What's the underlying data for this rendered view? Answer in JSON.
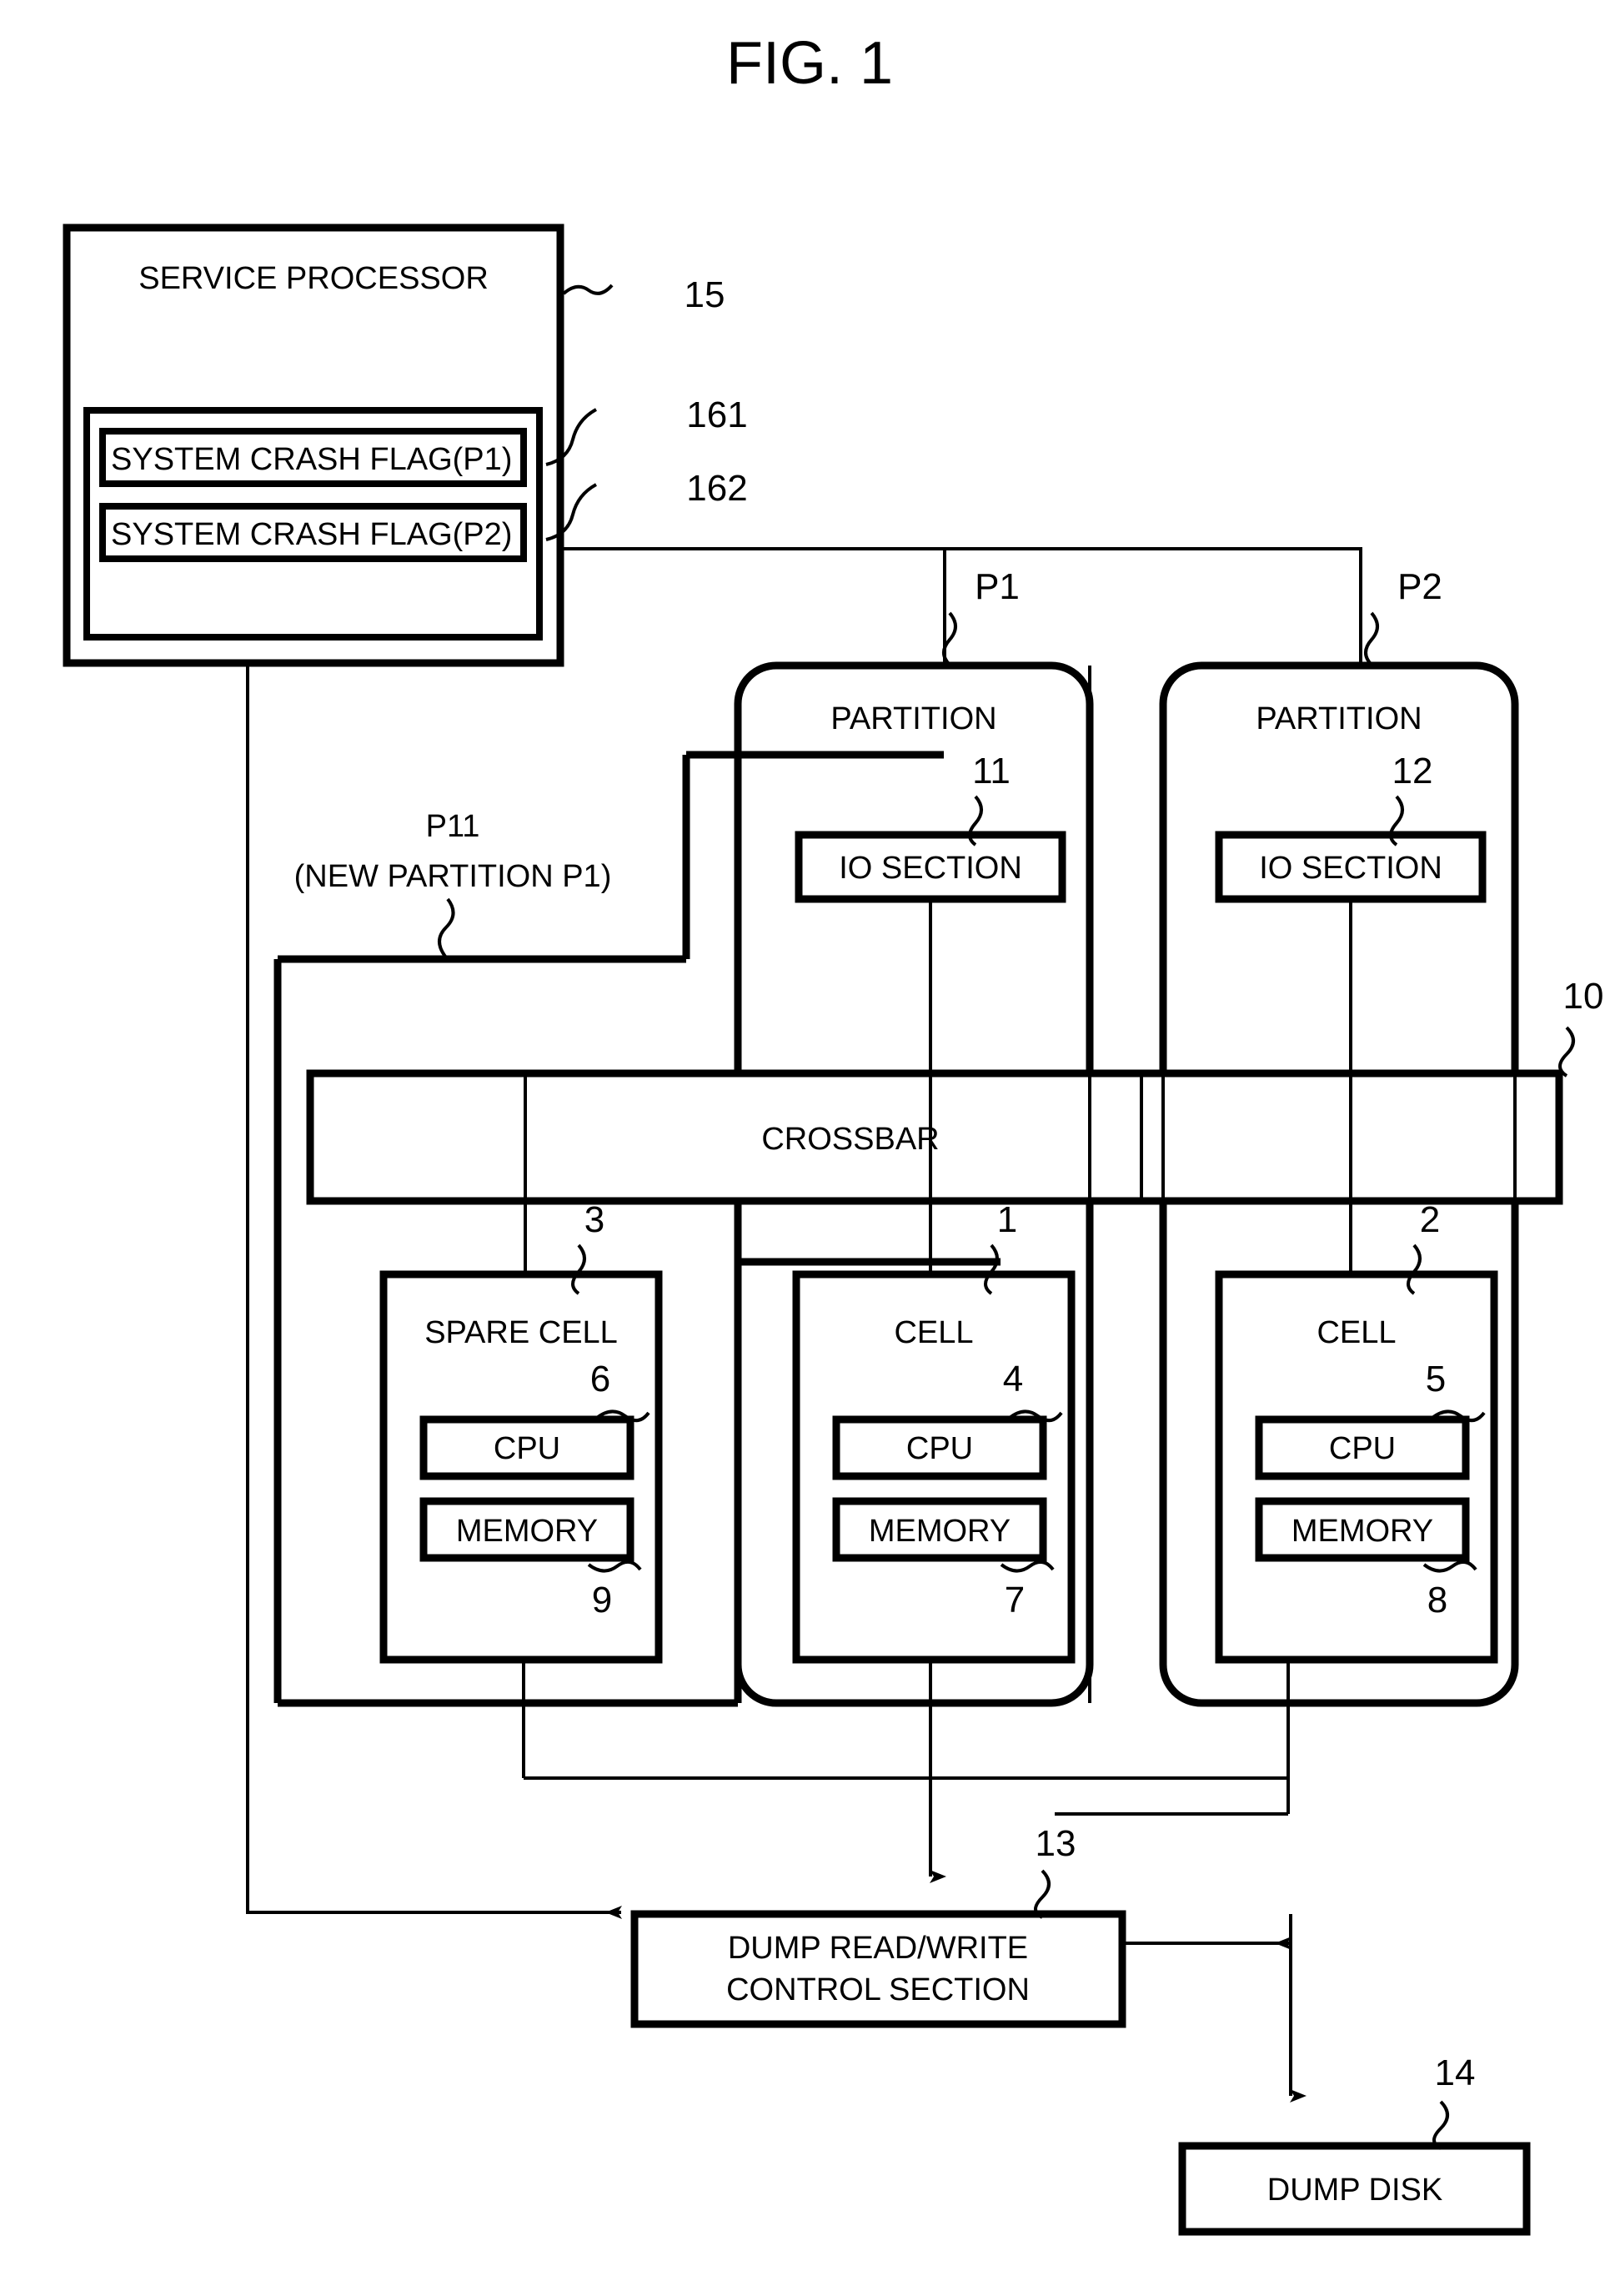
{
  "figure": {
    "title": "FIG. 1"
  },
  "service_processor": {
    "label": "SERVICE PROCESSOR",
    "ref": "15",
    "flags": [
      {
        "label": "SYSTEM CRASH FLAG(P1)",
        "ref": "161"
      },
      {
        "label": "SYSTEM CRASH FLAG(P2)",
        "ref": "162"
      }
    ]
  },
  "partitions": [
    {
      "label": "PARTITION",
      "ref": "P1",
      "io_section": {
        "label": "IO SECTION",
        "ref": "11"
      }
    },
    {
      "label": "PARTITION",
      "ref": "P2",
      "io_section": {
        "label": "IO SECTION",
        "ref": "12"
      }
    }
  ],
  "new_partition": {
    "ref": "P11",
    "note": "(NEW PARTITION P1)"
  },
  "crossbar": {
    "label": "CROSSBAR",
    "ref": "10"
  },
  "cells": [
    {
      "label": "SPARE CELL",
      "ref": "3",
      "cpu": {
        "label": "CPU",
        "ref": "6"
      },
      "memory": {
        "label": "MEMORY",
        "ref": "9"
      }
    },
    {
      "label": "CELL",
      "ref": "1",
      "cpu": {
        "label": "CPU",
        "ref": "4"
      },
      "memory": {
        "label": "MEMORY",
        "ref": "7"
      }
    },
    {
      "label": "CELL",
      "ref": "2",
      "cpu": {
        "label": "CPU",
        "ref": "5"
      },
      "memory": {
        "label": "MEMORY",
        "ref": "8"
      }
    }
  ],
  "dump_control": {
    "line1": "DUMP READ/WRITE",
    "line2": "CONTROL SECTION",
    "ref": "13"
  },
  "dump_disk": {
    "label": "DUMP DISK",
    "ref": "14"
  },
  "colors": {
    "ink": "#000000",
    "paper": "#ffffff"
  }
}
